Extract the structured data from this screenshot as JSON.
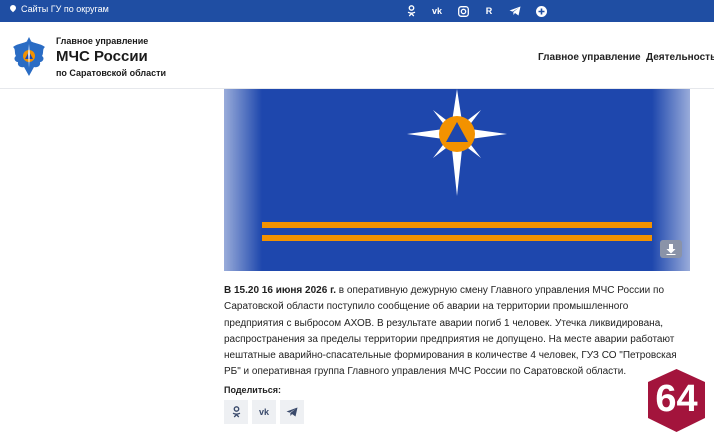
{
  "topbar": {
    "regions_label": "Сайты ГУ по округам",
    "socials": [
      "ok-icon",
      "vk-icon",
      "instagram-icon",
      "rutube-icon",
      "telegram-icon",
      "plus-icon"
    ],
    "color": "#1f4ea3"
  },
  "header": {
    "brand_line1": "Главное управление",
    "brand_line2": "МЧС России",
    "brand_line3": "по Саратовской области",
    "nav": [
      "Главное управление",
      "Деятельность"
    ]
  },
  "hero": {
    "background": "#1e47ad",
    "stripe_color": "#f39200"
  },
  "article": {
    "lead": "В 15.20 16 июня 2026 г.",
    "body": " в оперативную дежурную смену Главного управления МЧС России по Саратовской области поступило сообщение об аварии на территории промышленного предприятия с выбросом АХОВ. В результате аварии погиб 1 человек. Утечка ликвидирована, распространения за пределы территории предприятия не допущено. На месте аварии работают нештатные аварийно-спасательные формирования в количестве 4 человек, ГУЗ СО \"Петровская РБ\" и оперативная группа Главного управления МЧС России по Саратовской области."
  },
  "share": {
    "label": "Поделиться:",
    "buttons": [
      "ok-icon",
      "vk-icon",
      "telegram-icon"
    ]
  },
  "badge": {
    "text": "64",
    "color": "#a3143c"
  }
}
